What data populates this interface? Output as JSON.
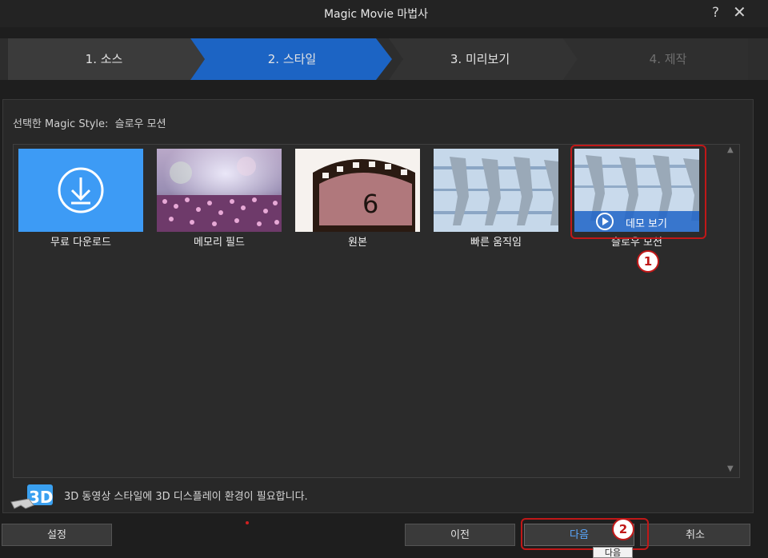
{
  "window": {
    "title": "Magic Movie 마법사",
    "help": "?",
    "close": "✕"
  },
  "steps": [
    {
      "label": "1. 소스",
      "state": "done"
    },
    {
      "label": "2. 스타일",
      "state": "active"
    },
    {
      "label": "3. 미리보기",
      "state": "pending"
    },
    {
      "label": "4. 제작",
      "state": "disabled"
    }
  ],
  "selected_style": {
    "prefix": "선택한 Magic Style:",
    "value": "슬로우 모션"
  },
  "styles": [
    {
      "label": "무료 다운로드",
      "icon": "download-icon"
    },
    {
      "label": "메모리 필드"
    },
    {
      "label": "원본"
    },
    {
      "label": "빠른 움직임"
    },
    {
      "label": "슬로우 모션",
      "demo_label": "데모 보기",
      "selected": true
    }
  ],
  "notice": "3D 동영상 스타일에 3D 디스플레이 환경이 필요합니다.",
  "badge_3d": "3D",
  "buttons": {
    "settings": "설정",
    "prev": "이전",
    "next": "다음",
    "cancel": "취소"
  },
  "tooltip": "다음",
  "annotations": {
    "one": "1",
    "two": "2"
  },
  "colors": {
    "accent": "#1f6fc9",
    "highlight": "#c01818",
    "download_tile": "#3d9bf5"
  }
}
